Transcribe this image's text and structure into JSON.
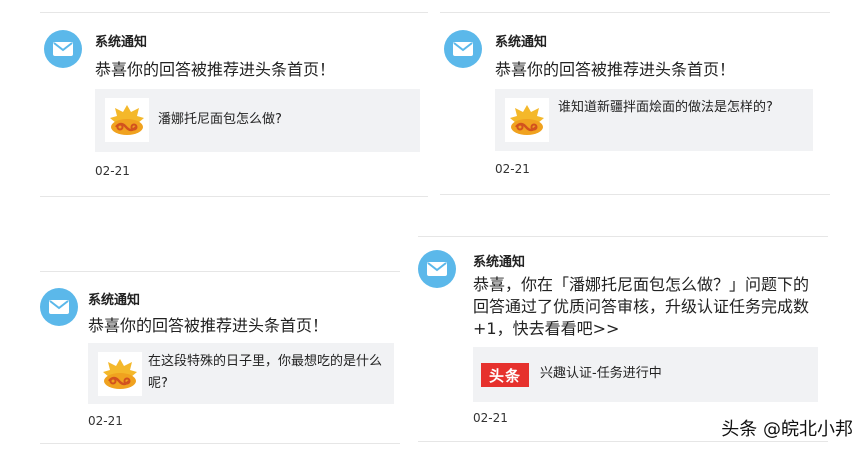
{
  "cards": [
    {
      "sender": "系统通知",
      "headline": "恭喜你的回答被推荐进头条首页！",
      "question": "潘娜托尼面包怎么做?",
      "date": "02-21"
    },
    {
      "sender": "系统通知",
      "headline": "恭喜你的回答被推荐进头条首页！",
      "question": "谁知道新疆拌面烩面的做法是怎样的?",
      "date": "02-21"
    },
    {
      "sender": "系统通知",
      "headline": "恭喜你的回答被推荐进头条首页！",
      "question": "在这段特殊的日子里，你最想吃的是什么呢?",
      "date": "02-21"
    },
    {
      "sender": "系统通知",
      "headline": "恭喜，你在「潘娜托尼面包怎么做？」问题下的回答通过了优质问答审核，升级认证任务完成数 +1，快去看看吧>>",
      "brand": "头条",
      "task": "兴趣认证-任务进行中",
      "date": "02-21"
    }
  ],
  "watermark": "头条 @皖北小邦",
  "colors": {
    "avatar": "#5bb8ea",
    "brand": "#e6312d",
    "box": "#f1f2f4"
  }
}
